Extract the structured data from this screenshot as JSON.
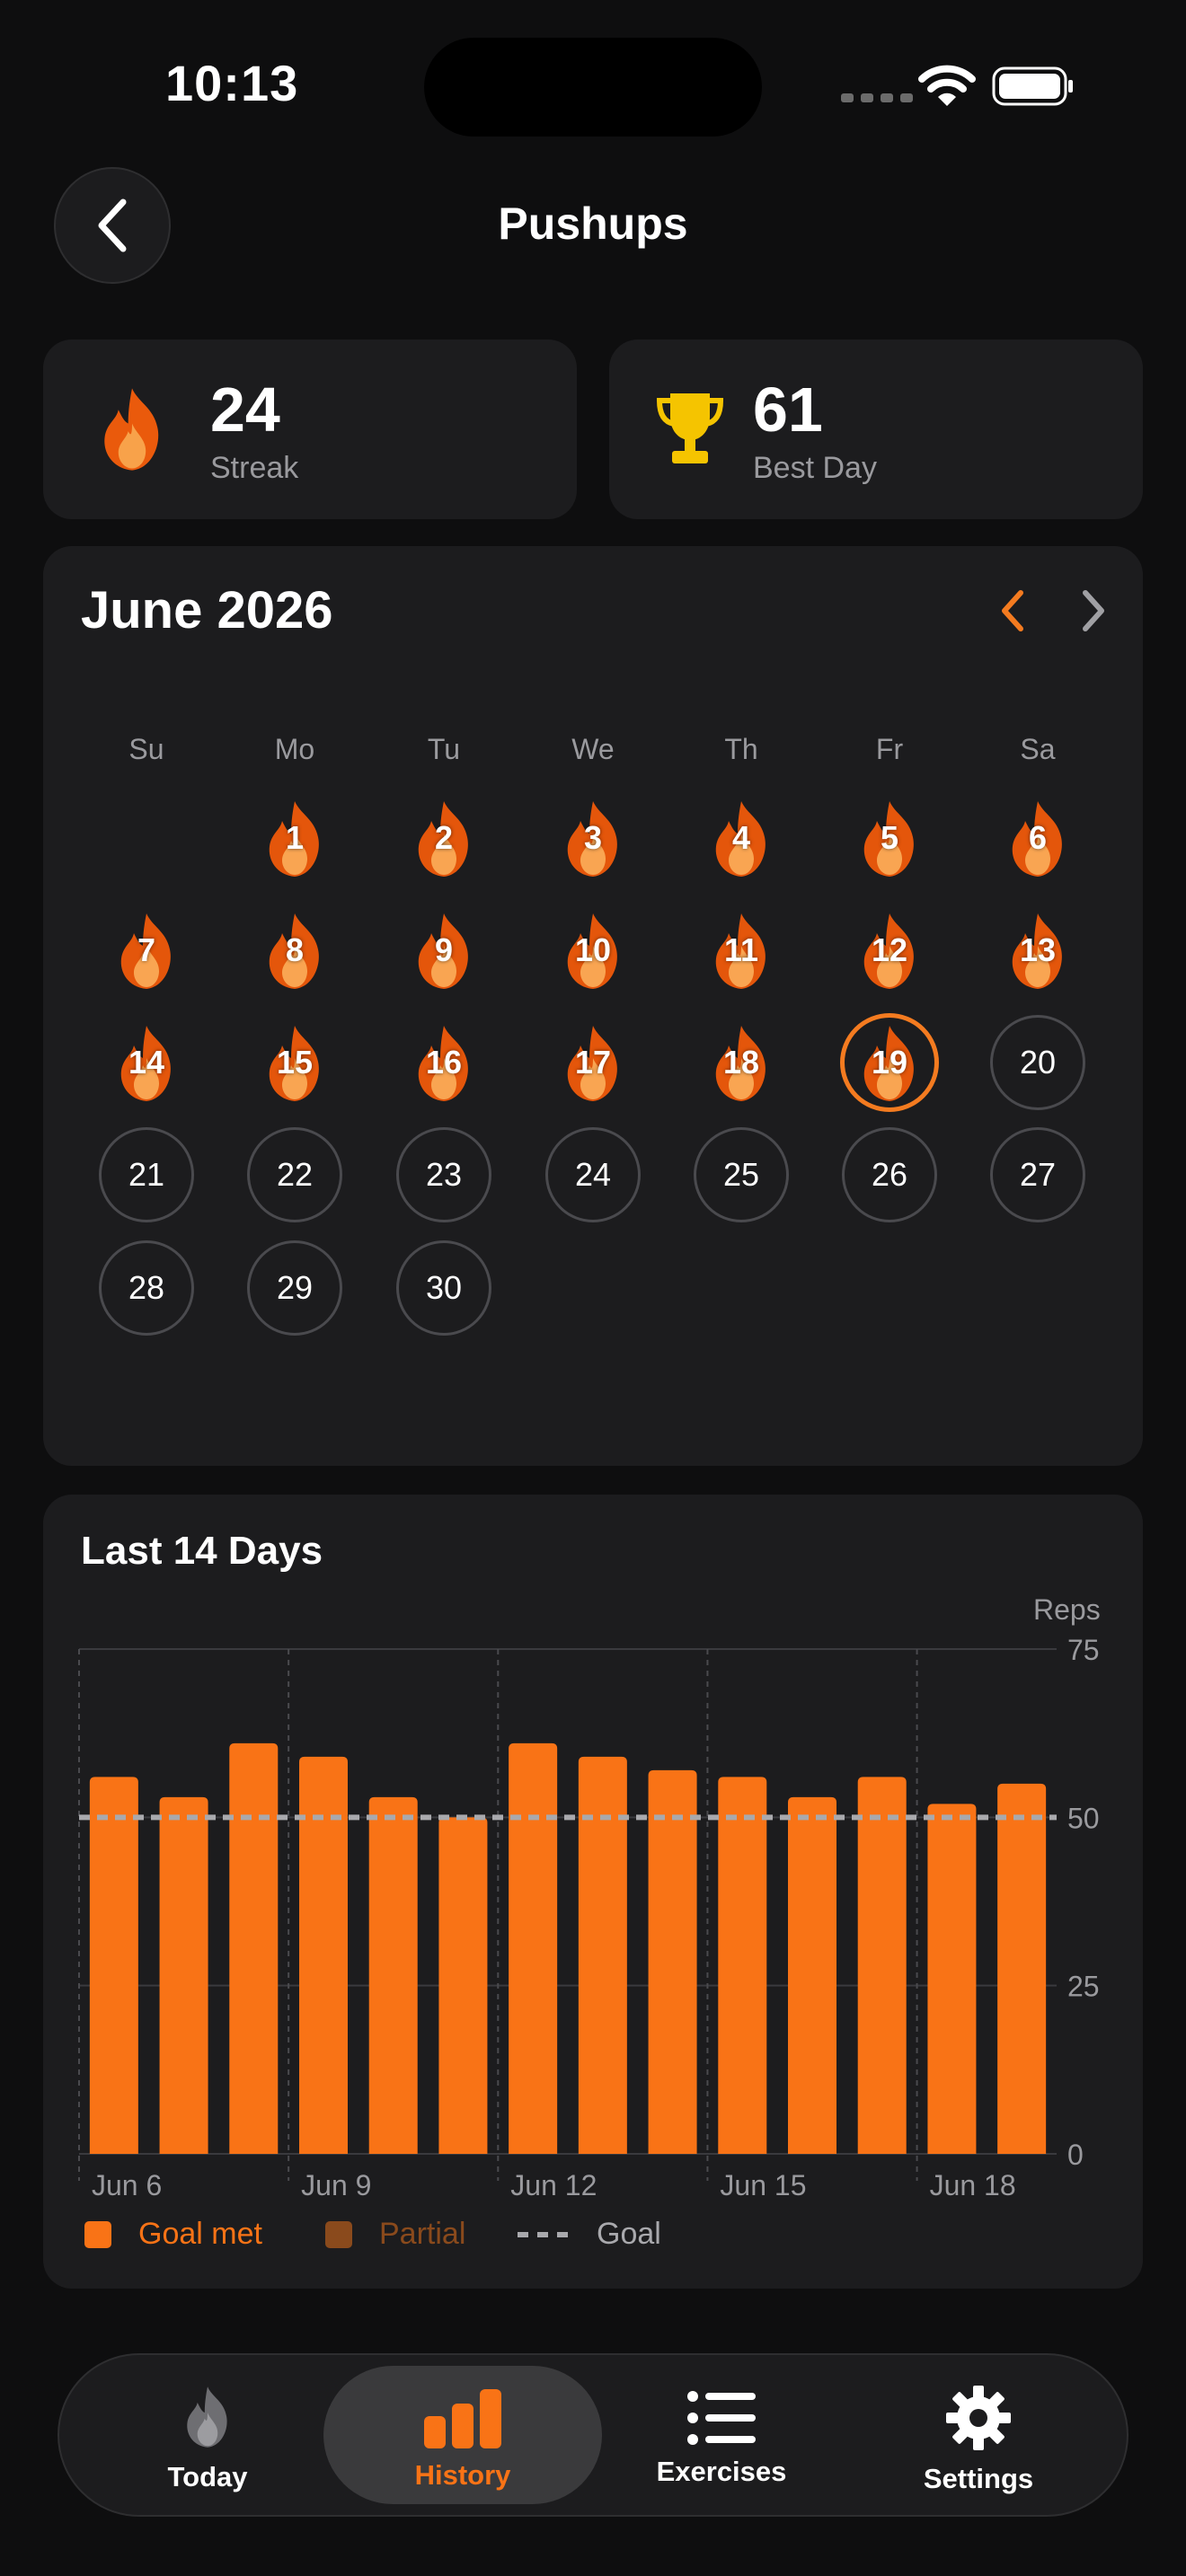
{
  "status_bar": {
    "time": "10:13"
  },
  "header": {
    "title": "Pushups"
  },
  "stats": [
    {
      "value": "24",
      "label": "Streak",
      "icon": "flame-icon"
    },
    {
      "value": "61",
      "label": "Best Day",
      "icon": "trophy-icon"
    }
  ],
  "calendar": {
    "month_title": "June 2026",
    "weekdays": [
      "Su",
      "Mo",
      "Tu",
      "We",
      "Th",
      "Fr",
      "Sa"
    ],
    "first_weekday_index": 1,
    "days_in_month": 30,
    "completed_days": [
      1,
      2,
      3,
      4,
      5,
      6,
      7,
      8,
      9,
      10,
      11,
      12,
      13,
      14,
      15,
      16,
      17,
      18,
      19
    ],
    "today": 19
  },
  "chart": {
    "title": "Last 14 Days",
    "legend": {
      "goal_met": "Goal met",
      "partial": "Partial",
      "goal": "Goal"
    }
  },
  "chart_data": {
    "type": "bar",
    "categories": [
      "Jun 6",
      "Jun 7",
      "Jun 8",
      "Jun 9",
      "Jun 10",
      "Jun 11",
      "Jun 12",
      "Jun 13",
      "Jun 14",
      "Jun 15",
      "Jun 16",
      "Jun 17",
      "Jun 18",
      "Jun 19"
    ],
    "values": [
      56,
      53,
      61,
      59,
      53,
      50,
      61,
      59,
      57,
      56,
      53,
      56,
      52,
      55
    ],
    "x_tick_labels": [
      "Jun 6",
      "Jun 9",
      "Jun 12",
      "Jun 15",
      "Jun 18"
    ],
    "x_tick_indices": [
      0,
      3,
      6,
      9,
      12
    ],
    "ylabel": "Reps",
    "ylim": [
      0,
      75
    ],
    "y_ticks": [
      0,
      25,
      50,
      75
    ],
    "goal": 50,
    "grid": true,
    "legend_placement": "bottom-left",
    "colors": {
      "goal_met": "#f97316",
      "partial": "#8a4a1c",
      "goal": "#a9a9ad"
    }
  },
  "tabs": [
    {
      "label": "Today",
      "icon": "flame-icon",
      "active": false
    },
    {
      "label": "History",
      "icon": "bar-chart-icon",
      "active": true
    },
    {
      "label": "Exercises",
      "icon": "list-icon",
      "active": false
    },
    {
      "label": "Settings",
      "icon": "gear-icon",
      "active": false
    }
  ],
  "colors": {
    "accent": "#f97316",
    "background": "#0e0e0f",
    "card": "#1c1c1e",
    "trophy": "#f5c400"
  }
}
